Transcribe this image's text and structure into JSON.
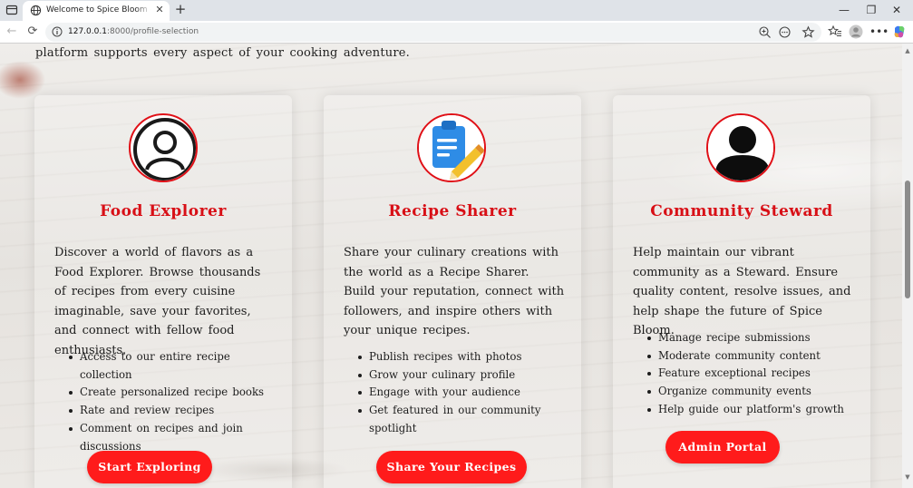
{
  "browser": {
    "tab_title": "Welcome to Spice Bloom - Your C",
    "url_host": "127.0.0.1",
    "url_path": ":8000/profile-selection",
    "tab_close": "✕",
    "new_tab": "+",
    "minimize": "—",
    "restore": "❐",
    "close": "✕",
    "back": "←",
    "reload": "⟳"
  },
  "intro": {
    "text": "platform supports every aspect of your cooking adventure."
  },
  "cards": [
    {
      "icon": "person-outline-icon",
      "title": "Food Explorer",
      "description": "Discover a world of flavors as a Food Explorer. Browse thousands of recipes from every cuisine imaginable, save your favorites, and connect with fellow food enthusiasts.",
      "features": [
        "Access to our entire recipe collection",
        "Create personalized recipe books",
        "Rate and review recipes",
        "Comment on recipes and join discussions"
      ],
      "button": "Start Exploring"
    },
    {
      "icon": "clipboard-pencil-icon",
      "title": "Recipe Sharer",
      "description": "Share your culinary creations with the world as a Recipe Sharer. Build your reputation, connect with followers, and inspire others with your unique recipes.",
      "features": [
        "Publish recipes with photos",
        "Grow your culinary profile",
        "Engage with your audience",
        "Get featured in our community spotlight"
      ],
      "button": "Share Your Recipes"
    },
    {
      "icon": "person-filled-icon",
      "title": "Community Steward",
      "description": "Help maintain our vibrant community as a Steward. Ensure quality content, resolve issues, and help shape the future of Spice Bloom.",
      "features": [
        "Manage recipe submissions",
        "Moderate community content",
        "Feature exceptional recipes",
        "Organize community events",
        "Help guide our platform's growth"
      ],
      "button": "Admin Portal"
    }
  ],
  "colors": {
    "accent": "#e00f16",
    "button": "#ff1b1b",
    "text": "#1c1c1c"
  }
}
